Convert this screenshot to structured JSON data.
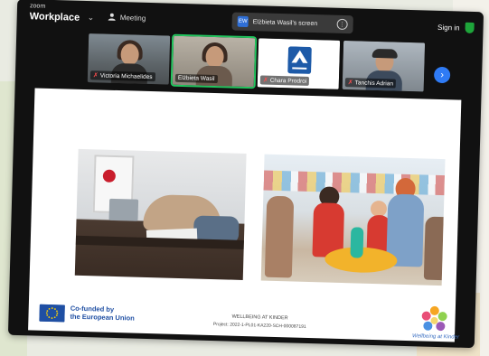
{
  "app": {
    "brand_small": "zoom",
    "brand": "Workplace",
    "meeting_label": "Meeting",
    "share_avatar": "EW",
    "share_label": "Elżbieta Wasil's screen",
    "signin_label": "Sign in"
  },
  "participants": [
    {
      "name": "Victoria Michaelides",
      "muted": true,
      "active": false
    },
    {
      "name": "Elżbieta Wasil",
      "muted": false,
      "active": true
    },
    {
      "name": "Chara Prodroi",
      "muted": true,
      "active": false
    },
    {
      "name": "Tanchis Adrian",
      "muted": true,
      "active": false
    }
  ],
  "slide": {
    "eu_line1": "Co-funded by",
    "eu_line2": "the European Union",
    "project_title": "WELLBEING AT KINDER",
    "project_id": "Project: 2022-1-PL01-KA220-SCH-000087191",
    "logo_text": "Wellbeing at Kinder"
  },
  "colors": {
    "accent": "#2f7bf5",
    "active_border": "#22c55e",
    "eu_blue": "#1f4fa3",
    "muted_red": "#ff4d4d"
  },
  "icons": {
    "meeting": "participants-icon",
    "share_menu": "share-options-icon",
    "security": "shield-icon",
    "next": "chevron-right-icon",
    "muted": "mic-off-icon"
  }
}
